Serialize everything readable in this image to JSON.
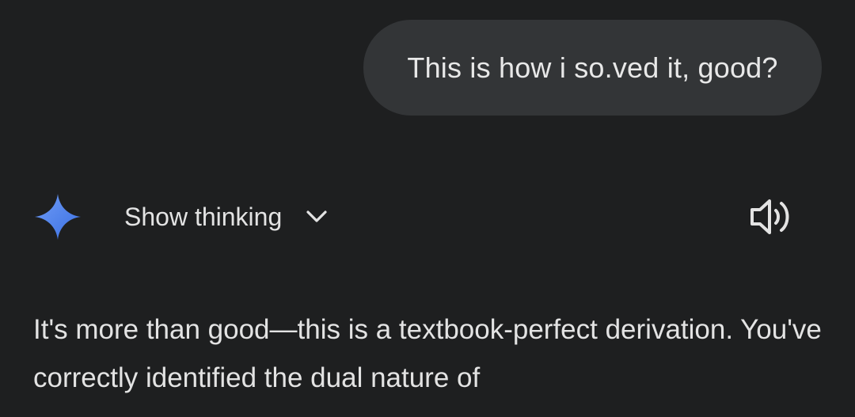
{
  "user_message": {
    "text": "This is how i so.ved it, good?"
  },
  "assistant": {
    "avatar_icon": "gemini-spark-icon",
    "show_thinking_label": "Show thinking",
    "toggle_icon": "chevron-down-icon",
    "read_aloud_icon": "speaker-icon",
    "response_text": "It's more than good—this is a textbook-perfect derivation. You've correctly identified the dual nature of"
  },
  "colors": {
    "background": "#1e1f20",
    "bubble": "#333537",
    "text": "#e3e3e3",
    "spark_top": "#5b8def",
    "spark_bottom": "#3d6ee0"
  }
}
